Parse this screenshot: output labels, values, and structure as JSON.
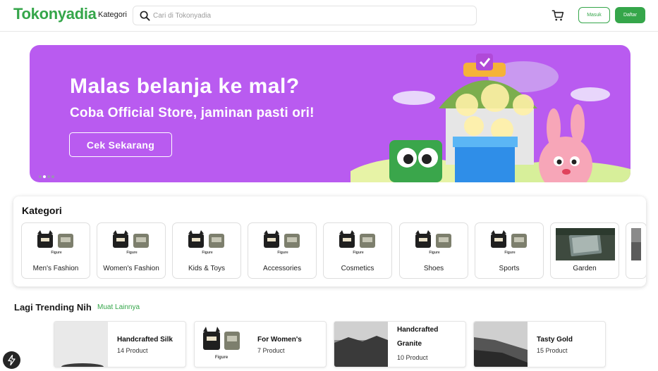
{
  "header": {
    "logo": "Tokonyadia",
    "kategori_link": "Kategori",
    "search_placeholder": "Cari di Tokonyadia",
    "login_label": "Masuk",
    "register_label": "Daftar"
  },
  "banner": {
    "title": "Malas belanja ke mal?",
    "subtitle": "Coba Official Store, jaminan pasti ori!",
    "cta_label": "Cek Sekarang",
    "slide_count": 4,
    "active_slide": 2
  },
  "categories": {
    "title": "Kategori",
    "items": [
      {
        "label": "Men's Fashion",
        "thumb": "Figure"
      },
      {
        "label": "Women's Fashion",
        "thumb": "Figure"
      },
      {
        "label": "Kids & Toys",
        "thumb": "Figure"
      },
      {
        "label": "Accessories",
        "thumb": "Figure"
      },
      {
        "label": "Cosmetics",
        "thumb": "Figure"
      },
      {
        "label": "Shoes",
        "thumb": "Figure"
      },
      {
        "label": "Sports",
        "thumb": "Figure"
      },
      {
        "label": "Garden",
        "thumb": ""
      }
    ]
  },
  "trending": {
    "title": "Lagi Trending Nih",
    "more_label": "Muat Lainnya",
    "items": [
      {
        "name": "Handcrafted Silk",
        "count": "14 Product"
      },
      {
        "name": "For Women's",
        "count": "7 Product",
        "thumb": "Figure"
      },
      {
        "name": "Handcrafted Granite",
        "count": "10 Product"
      },
      {
        "name": "Tasty Gold",
        "count": "15 Product"
      }
    ]
  },
  "colors": {
    "brand": "#35a64a",
    "banner_bg": "#b95bf0"
  },
  "icons": [
    "search-icon",
    "cart-icon",
    "bolt-icon"
  ]
}
